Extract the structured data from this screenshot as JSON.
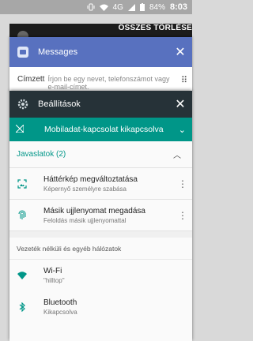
{
  "status_bar": {
    "battery": "84%",
    "time": "8:03",
    "network": "4G"
  },
  "recents": {
    "clear_all": "ÖSSZES TÖRLÉSE"
  },
  "messages_card": {
    "title": "Messages",
    "recipient_label": "Címzett",
    "recipient_placeholder": "Írjon be egy nevet, telefonszámot vagy e-mail-címet.",
    "accent": "#5871bf"
  },
  "settings_card": {
    "title": "Beállítások",
    "mobile_banner": "Mobiladat-kapcsolat kikapcsolva",
    "suggestions_header": "Javaslatok (2)",
    "suggestions": [
      {
        "title": "Háttérkép megváltoztatása",
        "subtitle": "Képernyő személyre szabása",
        "icon": "wallpaper-icon"
      },
      {
        "title": "Másik ujjlenyomat megadása",
        "subtitle": "Feloldás másik ujjlenyomattal",
        "icon": "fingerprint-icon"
      }
    ],
    "section_title": "Vezeték nélküli és egyéb hálózatok",
    "items": [
      {
        "title": "Wi-Fi",
        "subtitle": "\"hilltop\"",
        "icon": "wifi-icon"
      },
      {
        "title": "Bluetooth",
        "subtitle": "Kikapcsolva",
        "icon": "bluetooth-icon"
      }
    ],
    "accent": "#009688",
    "header_color": "#263238"
  }
}
